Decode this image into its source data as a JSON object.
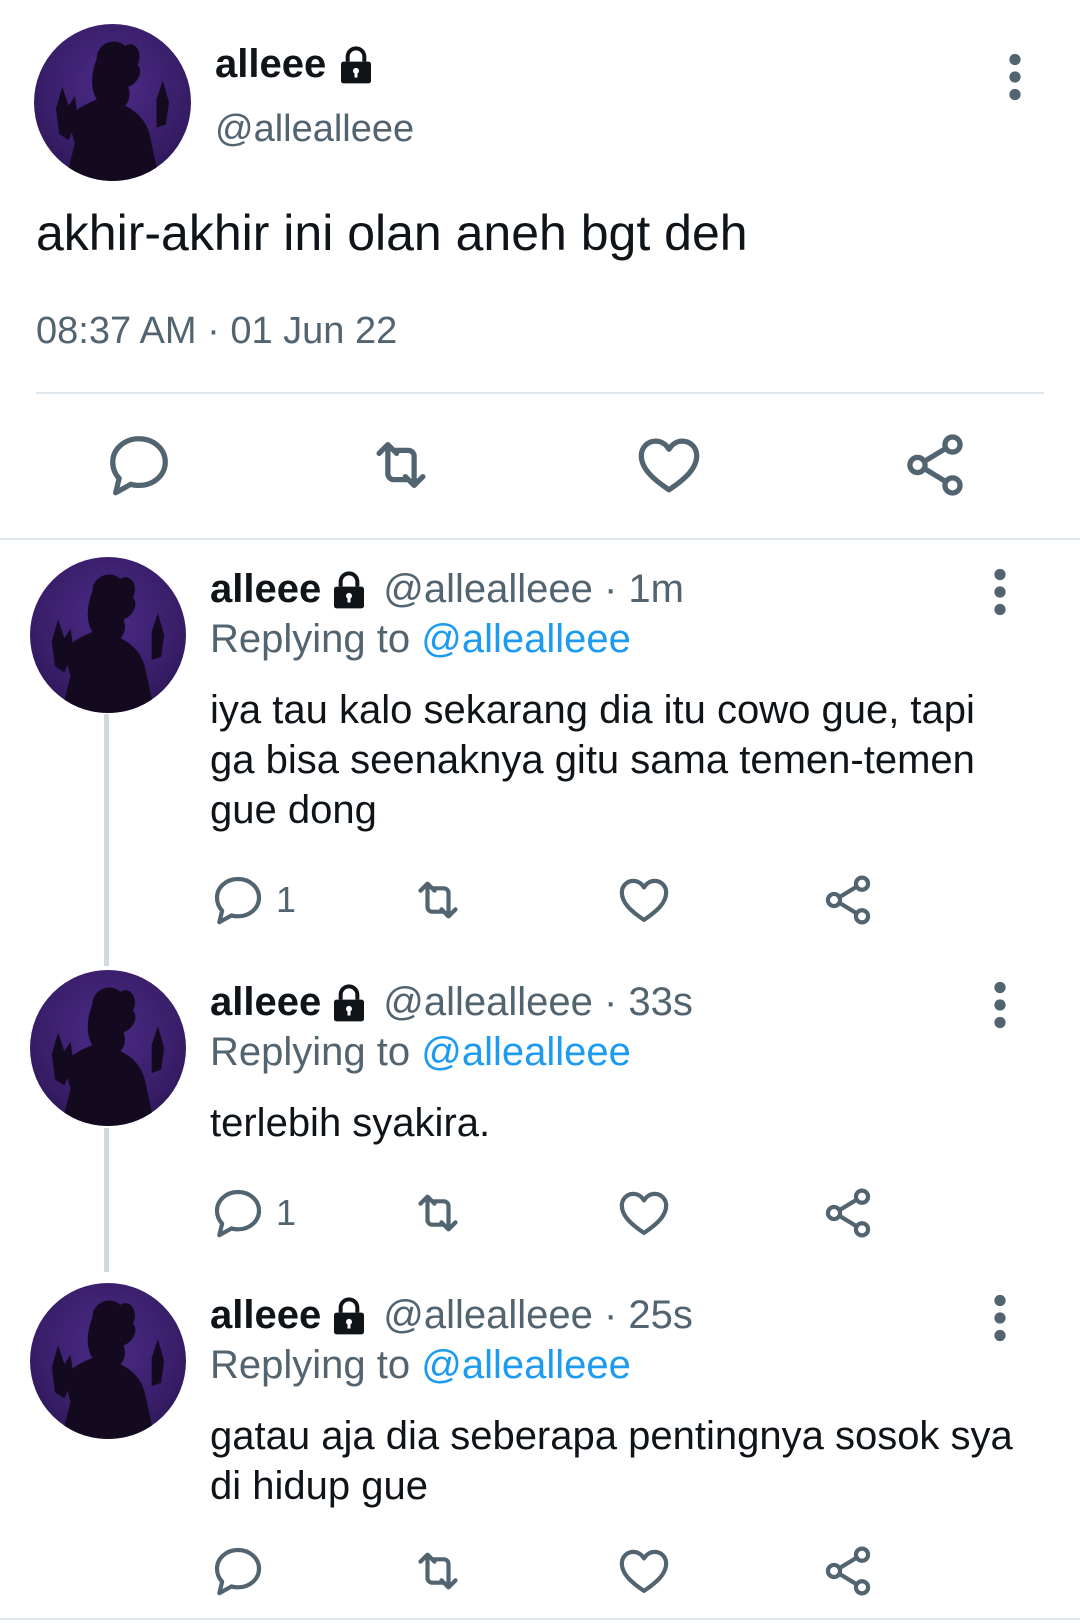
{
  "main_tweet": {
    "name": "alleee",
    "handle": "@allealleee",
    "text": "akhir-akhir ini olan aneh bgt deh",
    "timestamp": "08:37 AM · 01 Jun 22",
    "icons": [
      "reply-icon",
      "retweet-icon",
      "like-icon",
      "share-icon",
      "more-icon",
      "lock-icon"
    ]
  },
  "replies": [
    {
      "name": "alleee",
      "handle_time": "@allealleee · 1m",
      "replying_prefix": "Replying to",
      "replying_to": "@allealleee",
      "text": "iya tau kalo sekarang dia itu cowo gue, tapi ga bisa seenaknya gitu sama temen-temen gue dong",
      "reply_count": "1"
    },
    {
      "name": "alleee",
      "handle_time": "@allealleee · 33s",
      "replying_prefix": "Replying to",
      "replying_to": "@allealleee",
      "text": "terlebih syakira.",
      "reply_count": "1"
    },
    {
      "name": "alleee",
      "handle_time": "@allealleee · 25s",
      "replying_prefix": "Replying to",
      "replying_to": "@allealleee",
      "text": "gatau aja dia seberapa pentingnya sosok sya di hidup gue",
      "reply_count": ""
    }
  ],
  "colors": {
    "text": "#0f1419",
    "secondary": "#536471",
    "link": "#1d9bf0",
    "divider": "#e1e8ed",
    "avatar_bg": "#3a1f6b"
  }
}
